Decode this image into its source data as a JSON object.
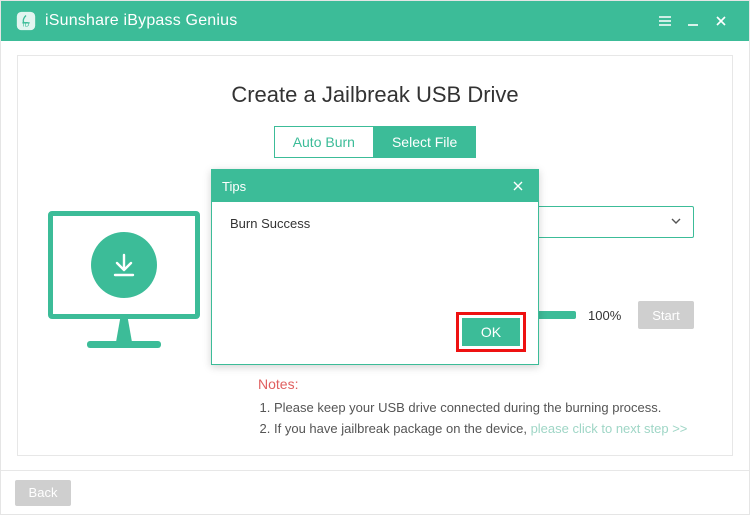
{
  "colors": {
    "accent": "#3cbc98",
    "highlight": "#e11",
    "notes_title": "#e06060"
  },
  "app": {
    "title": "iSunshare iBypass Genius"
  },
  "page": {
    "title": "Create a Jailbreak USB Drive"
  },
  "tabs": {
    "auto_burn": "Auto Burn",
    "select_file": "Select File"
  },
  "progress": {
    "percent_label": "100%",
    "percent_value": 100,
    "start_label": "Start"
  },
  "notes": {
    "title": "Notes:",
    "line1": "Please keep your USB drive connected during the burning process.",
    "line2_a": "If you have jailbreak package on the device, ",
    "line2_link": "please click to next step >>"
  },
  "footer": {
    "back": "Back"
  },
  "modal": {
    "title": "Tips",
    "message": "Burn Success",
    "ok": "OK"
  }
}
